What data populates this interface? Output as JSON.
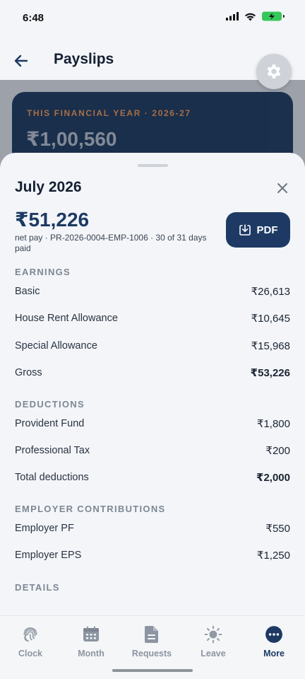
{
  "status_bar": {
    "time": "6:48"
  },
  "header": {
    "title": "Payslips"
  },
  "fy_card": {
    "label": "THIS FINANCIAL YEAR · 2026-27",
    "amount": "₹1,00,560"
  },
  "sheet": {
    "title": "July 2026",
    "net_amount": "₹51,226",
    "net_subtitle": "net pay · PR-2026-0004-EMP-1006 · 30 of 31 days paid",
    "pdf_label": "PDF",
    "sections": {
      "earnings": {
        "heading": "EARNINGS",
        "rows": [
          {
            "label": "Basic",
            "value": "₹26,613"
          },
          {
            "label": "House Rent Allowance",
            "value": "₹10,645"
          },
          {
            "label": "Special Allowance",
            "value": "₹15,968"
          },
          {
            "label": "Gross",
            "value": "₹53,226"
          }
        ]
      },
      "deductions": {
        "heading": "DEDUCTIONS",
        "rows": [
          {
            "label": "Provident Fund",
            "value": "₹1,800"
          },
          {
            "label": "Professional Tax",
            "value": "₹200"
          },
          {
            "label": "Total deductions",
            "value": "₹2,000"
          }
        ]
      },
      "employer": {
        "heading": "EMPLOYER CONTRIBUTIONS",
        "rows": [
          {
            "label": "Employer PF",
            "value": "₹550"
          },
          {
            "label": "Employer EPS",
            "value": "₹1,250"
          }
        ]
      },
      "details": {
        "heading": "DETAILS"
      }
    }
  },
  "bottom_nav": {
    "items": [
      {
        "label": "Clock",
        "icon": "fingerprint-icon"
      },
      {
        "label": "Month",
        "icon": "calendar-icon"
      },
      {
        "label": "Requests",
        "icon": "document-icon"
      },
      {
        "label": "Leave",
        "icon": "sun-icon"
      },
      {
        "label": "More",
        "icon": "more-icon",
        "active": true
      }
    ]
  },
  "colors": {
    "primary": "#1e3a64",
    "accent_label": "#a86a40",
    "battery": "#34c759"
  }
}
